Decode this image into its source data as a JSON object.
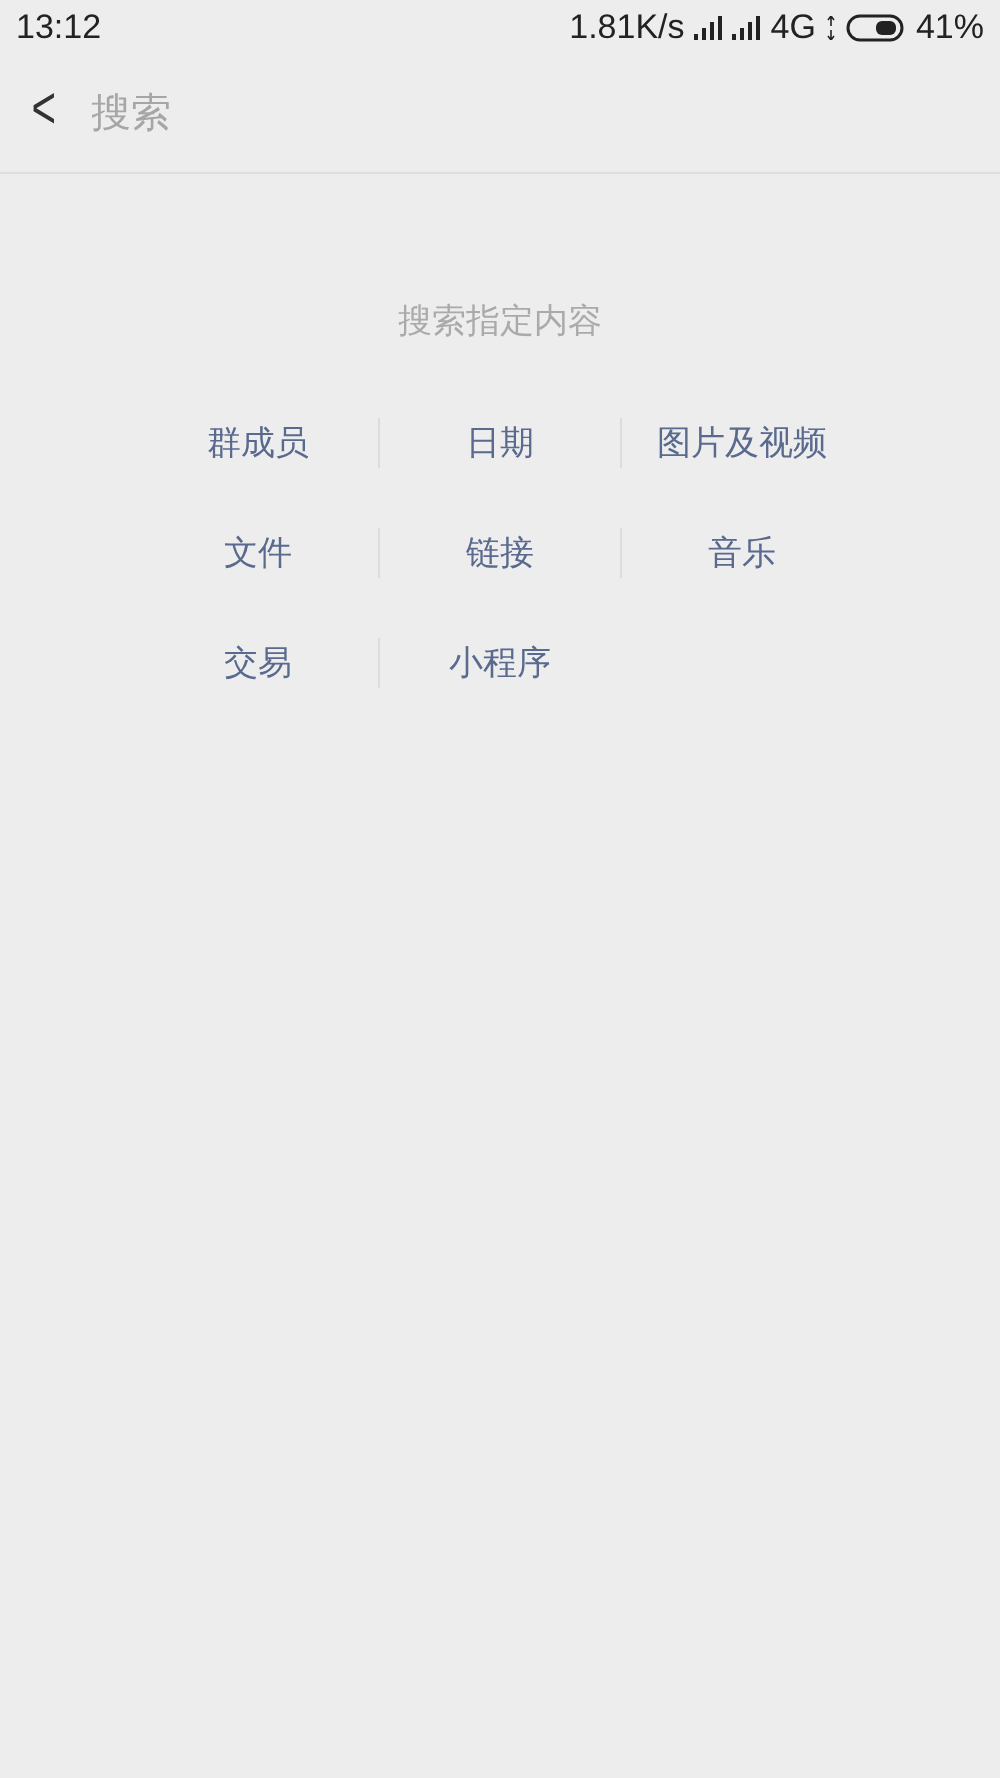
{
  "status_bar": {
    "time": "13:12",
    "speed": "1.81K/s",
    "network": "4G",
    "battery": "41%"
  },
  "header": {
    "back": "<",
    "placeholder": "搜索"
  },
  "hint": "搜索指定内容",
  "categories": [
    {
      "label": "群成员"
    },
    {
      "label": "日期"
    },
    {
      "label": "图片及视频"
    },
    {
      "label": "文件"
    },
    {
      "label": "链接"
    },
    {
      "label": "音乐"
    },
    {
      "label": "交易"
    },
    {
      "label": "小程序"
    }
  ]
}
